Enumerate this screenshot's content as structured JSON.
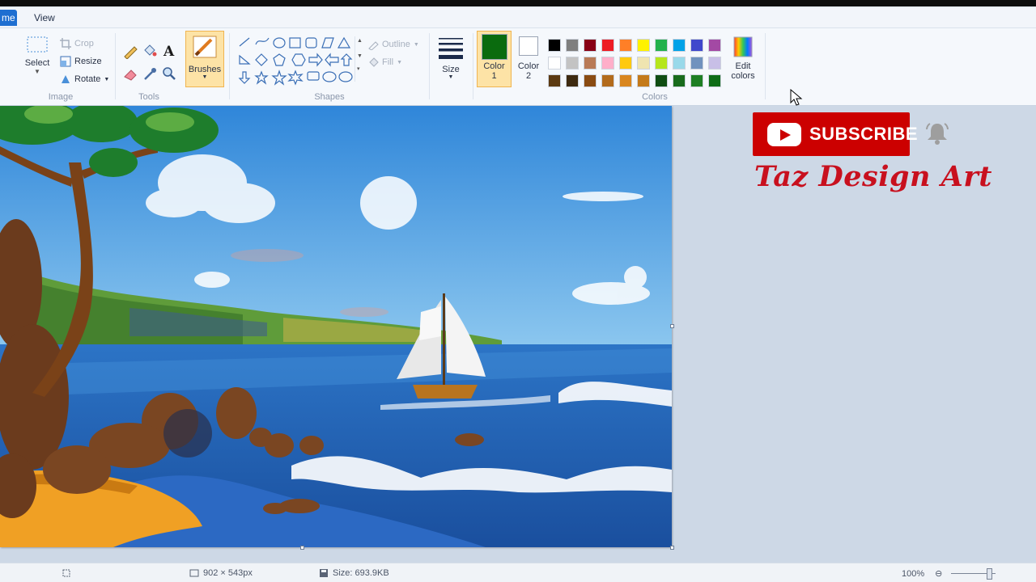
{
  "tabs": [
    {
      "label": "me"
    },
    {
      "label": "View"
    }
  ],
  "ribbon": {
    "image": {
      "label": "Image",
      "select_label": "Select",
      "crop_label": "Crop",
      "resize_label": "Resize",
      "rotate_label": "Rotate"
    },
    "tools": {
      "label": "Tools"
    },
    "brushes": {
      "label": "Brushes"
    },
    "shapes": {
      "label": "Shapes",
      "outline_label": "Outline",
      "fill_label": "Fill"
    },
    "size": {
      "label": "Size"
    },
    "color1": {
      "label": "Color",
      "number": "1",
      "value": "#0a6b0e"
    },
    "color2": {
      "label": "Color",
      "number": "2",
      "value": "#ffffff"
    },
    "colors": {
      "label": "Colors",
      "edit_label_1": "Edit",
      "edit_label_2": "colors",
      "palette": [
        [
          "#000000",
          "#7f7f7f",
          "#880015",
          "#ed1c24",
          "#ff7f27",
          "#fff200",
          "#22b14c",
          "#00a2e8",
          "#3f48cc",
          "#a349a4"
        ],
        [
          "#ffffff",
          "#c3c3c3",
          "#b97a57",
          "#ffaec9",
          "#ffc90e",
          "#efe4b0",
          "#b5e61d",
          "#99d9ea",
          "#7092be",
          "#c8bfe7"
        ],
        [
          "#5c3a12",
          "#3e2a10",
          "#8a4b12",
          "#b36b1c",
          "#d9861f",
          "#c47a1a",
          "#0f4d12",
          "#186b1c",
          "#1e7f24",
          "#0f6d17"
        ]
      ]
    }
  },
  "status": {
    "dimensions": "902 × 543px",
    "size": "Size: 693.9KB",
    "zoom": "100%"
  },
  "overlay": {
    "subscribe_label": "SUBSCRIBE",
    "brand": "Taz Design Art"
  },
  "colors": {
    "accent": "#1f6fd1",
    "subscribe_red": "#cc0000",
    "brand_red": "#c8101e",
    "ribbon_bg": "#f5f8fc",
    "workspace": "#cdd8e6"
  }
}
